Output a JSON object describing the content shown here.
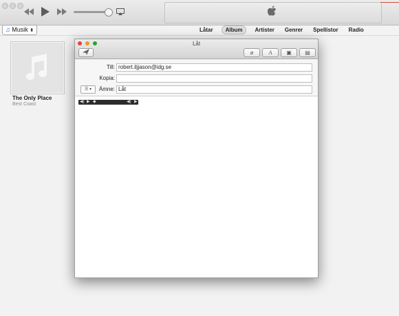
{
  "itunes": {
    "library_selector": "Musik",
    "tabs": [
      {
        "label": "Låtar",
        "active": false
      },
      {
        "label": "Album",
        "active": true
      },
      {
        "label": "Artister",
        "active": false
      },
      {
        "label": "Genrer",
        "active": false
      },
      {
        "label": "Spellistor",
        "active": false
      },
      {
        "label": "Radio",
        "active": false
      }
    ],
    "album": {
      "title": "The Only Place",
      "artist": "Best Coast"
    }
  },
  "mail": {
    "window_title": "Låt",
    "to_label": "Till:",
    "to_value": "robert.iljjason@idg.se",
    "cc_label": "Kopia:",
    "cc_value": "",
    "subject_label": "Ämne:",
    "subject_value": "Låt"
  },
  "colors": {
    "accent_red": "#d14a3c",
    "close": "#e0443e",
    "minimize": "#dea123",
    "zoom": "#1aab29"
  }
}
